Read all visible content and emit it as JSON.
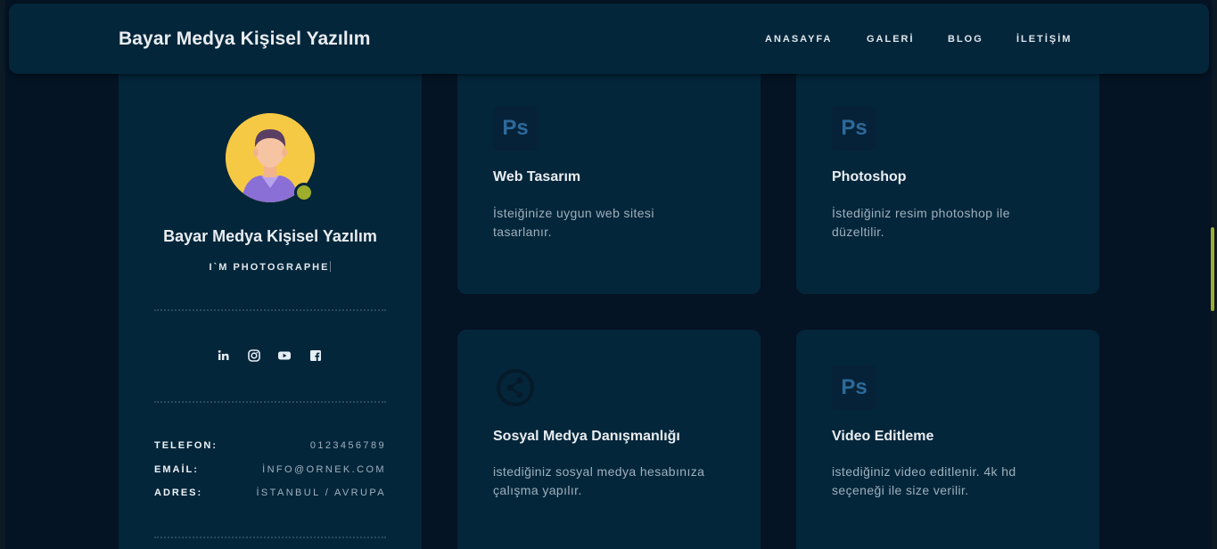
{
  "header": {
    "brand": "Bayar Medya Kişisel Yazılım",
    "nav": [
      "ANASAYFA",
      "GALERİ",
      "BLOG",
      "İLETİŞİM"
    ]
  },
  "profile": {
    "name": "Bayar Medya Kişisel Yazılım",
    "role": "I`M PHOTOGRAPHE",
    "socials": [
      "linkedin-icon",
      "instagram-icon",
      "youtube-icon",
      "facebook-icon"
    ],
    "info": [
      {
        "label": "TELEFON:",
        "value": "0123456789"
      },
      {
        "label": "EMAİL:",
        "value": "İNFO@ORNEK.COM"
      },
      {
        "label": "ADRES:",
        "value": "İSTANBUL / AVRUPA"
      }
    ]
  },
  "services": [
    {
      "icon": "photoshop-icon",
      "icon_text": "Ps",
      "title": "Web Tasarım",
      "desc": "İsteiğinize uygun web sitesi tasarlanır."
    },
    {
      "icon": "photoshop-icon",
      "icon_text": "Ps",
      "title": "Photoshop",
      "desc": "İstediğiniz resim photoshop ile düzeltilir."
    },
    {
      "icon": "share-icon",
      "icon_text": "",
      "title": "Sosyal Medya Danışmanlığı",
      "desc": "istediğiniz sosyal medya hesabınıza çalışma yapılır."
    },
    {
      "icon": "photoshop-icon",
      "icon_text": "Ps",
      "title": "Video Editleme",
      "desc": "istediğiniz video editlenir. 4k hd seçeneği ile size verilir."
    }
  ],
  "colors": {
    "background": "#041424",
    "card": "#04263a",
    "accent": "#9eae2c",
    "ps_icon": "#2c6a9a"
  }
}
